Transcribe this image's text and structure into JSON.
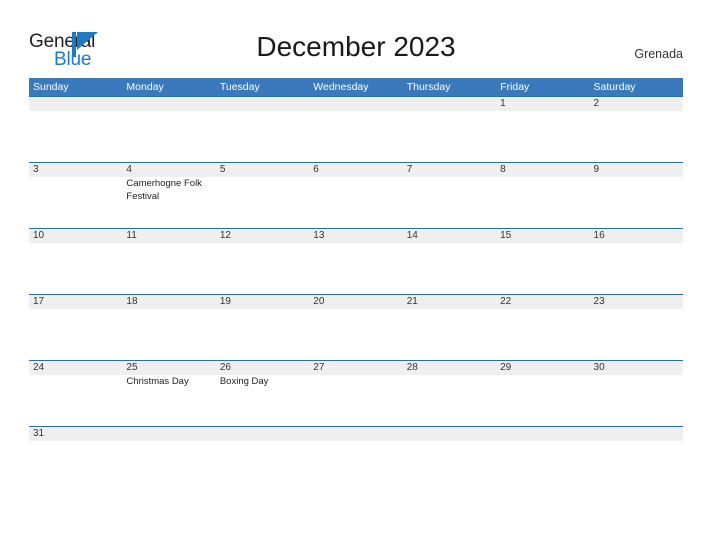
{
  "brand": {
    "word_one": "General",
    "word_two": "Blue",
    "flag_icon": "flag-triangle-icon",
    "accent_color": "#1f7ac4"
  },
  "header": {
    "title": "December 2023",
    "country": "Grenada"
  },
  "theme": {
    "header_blue": "#3b79bd",
    "divider_blue": "#2a6cb0",
    "row_band_gray": "#efefef",
    "page_background": "#ffffff"
  },
  "calendar": {
    "weekdays": [
      "Sunday",
      "Monday",
      "Tuesday",
      "Wednesday",
      "Thursday",
      "Friday",
      "Saturday"
    ],
    "weeks": [
      {
        "days": [
          {
            "num": "",
            "event": ""
          },
          {
            "num": "",
            "event": ""
          },
          {
            "num": "",
            "event": ""
          },
          {
            "num": "",
            "event": ""
          },
          {
            "num": "",
            "event": ""
          },
          {
            "num": "1",
            "event": ""
          },
          {
            "num": "2",
            "event": ""
          }
        ]
      },
      {
        "days": [
          {
            "num": "3",
            "event": ""
          },
          {
            "num": "4",
            "event": "Camerhogne Folk Festival"
          },
          {
            "num": "5",
            "event": ""
          },
          {
            "num": "6",
            "event": ""
          },
          {
            "num": "7",
            "event": ""
          },
          {
            "num": "8",
            "event": ""
          },
          {
            "num": "9",
            "event": ""
          }
        ]
      },
      {
        "days": [
          {
            "num": "10",
            "event": ""
          },
          {
            "num": "11",
            "event": ""
          },
          {
            "num": "12",
            "event": ""
          },
          {
            "num": "13",
            "event": ""
          },
          {
            "num": "14",
            "event": ""
          },
          {
            "num": "15",
            "event": ""
          },
          {
            "num": "16",
            "event": ""
          }
        ]
      },
      {
        "days": [
          {
            "num": "17",
            "event": ""
          },
          {
            "num": "18",
            "event": ""
          },
          {
            "num": "19",
            "event": ""
          },
          {
            "num": "20",
            "event": ""
          },
          {
            "num": "21",
            "event": ""
          },
          {
            "num": "22",
            "event": ""
          },
          {
            "num": "23",
            "event": ""
          }
        ]
      },
      {
        "days": [
          {
            "num": "24",
            "event": ""
          },
          {
            "num": "25",
            "event": "Christmas Day"
          },
          {
            "num": "26",
            "event": "Boxing Day"
          },
          {
            "num": "27",
            "event": ""
          },
          {
            "num": "28",
            "event": ""
          },
          {
            "num": "29",
            "event": ""
          },
          {
            "num": "30",
            "event": ""
          }
        ]
      },
      {
        "days": [
          {
            "num": "31",
            "event": ""
          },
          {
            "num": "",
            "event": ""
          },
          {
            "num": "",
            "event": ""
          },
          {
            "num": "",
            "event": ""
          },
          {
            "num": "",
            "event": ""
          },
          {
            "num": "",
            "event": ""
          },
          {
            "num": "",
            "event": ""
          }
        ]
      }
    ]
  }
}
